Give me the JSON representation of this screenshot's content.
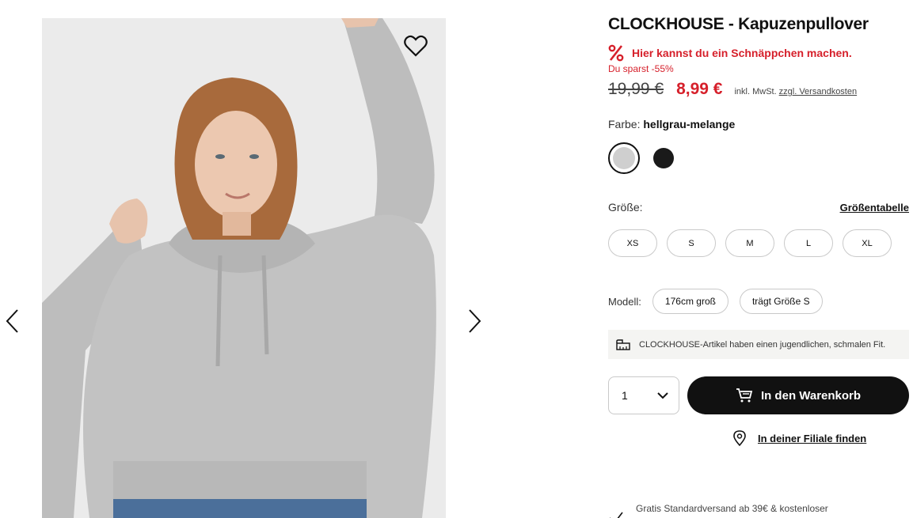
{
  "gallery": {
    "image_alt": "Model trägt hellgrau-melange Kapuzenpullover",
    "wishlist_icon": "heart-icon",
    "prev_icon": "chevron-left-icon",
    "next_icon": "chevron-right-icon"
  },
  "product": {
    "title": "CLOCKHOUSE - Kapuzenpullover",
    "deal_text": "Hier kannst du ein Schnäppchen machen.",
    "savings": "Du sparst -55%",
    "old_price": "19,99 €",
    "new_price": "8,99 €",
    "tax_note": "inkl. MwSt.",
    "shipping_link": "zzgl. Versandkosten"
  },
  "color": {
    "label": "Farbe: ",
    "selected": "hellgrau-melange",
    "swatches": [
      "#cfcfcf",
      "#1a1a1a"
    ]
  },
  "size": {
    "label": "Größe:",
    "table_link": "Größentabelle",
    "options": [
      "XS",
      "S",
      "M",
      "L",
      "XL"
    ]
  },
  "model": {
    "label": "Modell:",
    "height": "176cm groß",
    "wears": "trägt Größe S"
  },
  "fit_note": "CLOCKHOUSE-Artikel haben einen jugendlichen, schmalen Fit.",
  "purchase": {
    "quantity": "1",
    "cart_label": "In den Warenkorb",
    "store_label": "In deiner Filiale finden"
  },
  "shipping_note": "Gratis Standardversand ab 39€ & kostenloser",
  "colors": {
    "accent_red": "#d6202b",
    "button_black": "#111111"
  }
}
